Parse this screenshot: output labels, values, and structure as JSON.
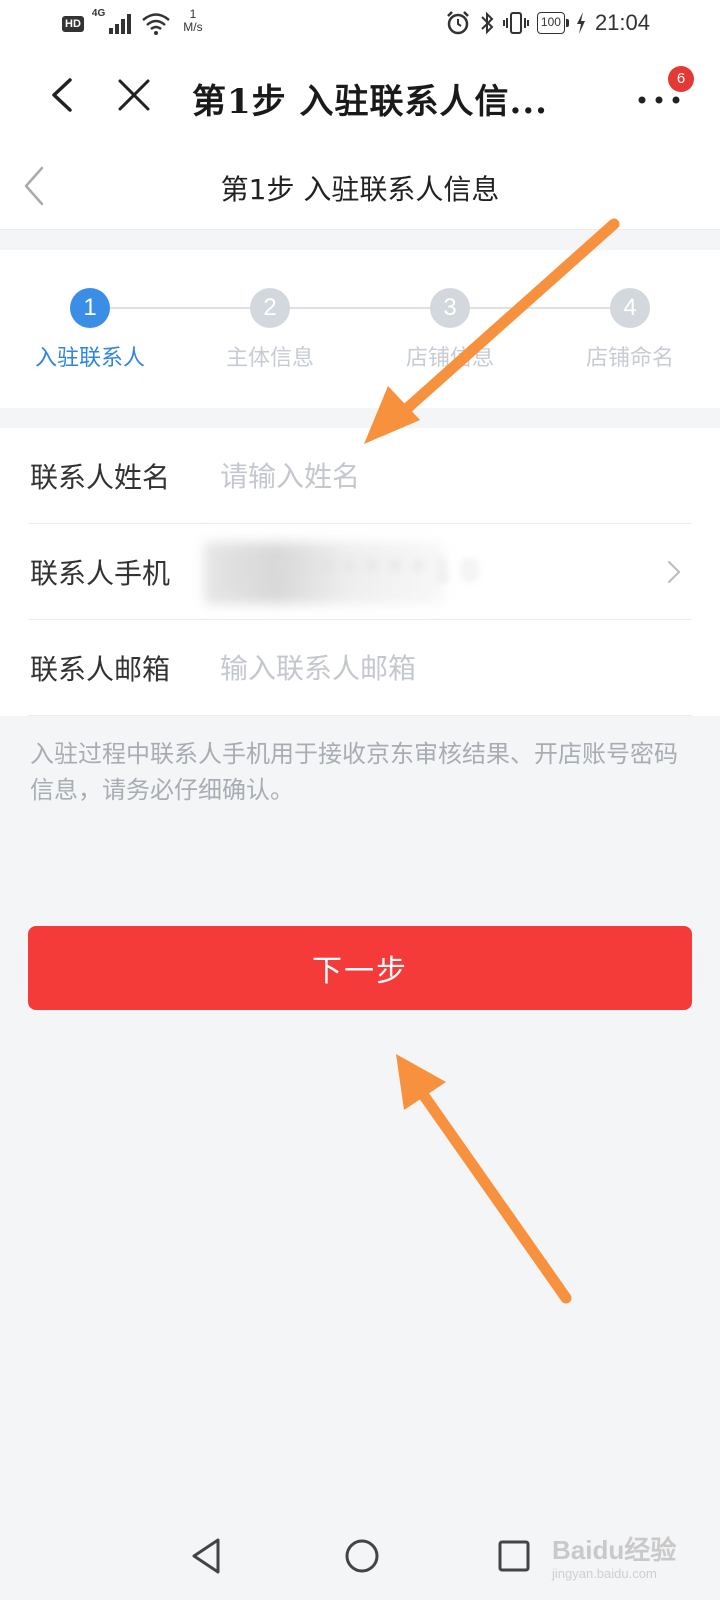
{
  "status_bar": {
    "hd": "HD",
    "network": "4G",
    "speed_value": "1",
    "speed_unit": "M/s",
    "battery": "100",
    "time": "21:04",
    "icons": [
      "alarm-icon",
      "bluetooth-icon",
      "vibrate-icon",
      "charging-icon"
    ]
  },
  "app_bar": {
    "title": "第1步 入驻联系人信...",
    "badge_count": "6"
  },
  "nav_bar": {
    "title": "第1步 入驻联系人信息"
  },
  "steps": [
    {
      "number": "1",
      "label": "入驻联系人",
      "active": true
    },
    {
      "number": "2",
      "label": "主体信息",
      "active": false
    },
    {
      "number": "3",
      "label": "店铺信息",
      "active": false
    },
    {
      "number": "4",
      "label": "店铺命名",
      "active": false
    }
  ],
  "form": {
    "name": {
      "label": "联系人姓名",
      "placeholder": "请输入姓名"
    },
    "phone": {
      "label": "联系人手机",
      "value": "1 * * * * * * * * 1 0"
    },
    "email": {
      "label": "联系人邮箱",
      "placeholder": "输入联系人邮箱"
    }
  },
  "notice": "入驻过程中联系人手机用于接收京东审核结果、开店账号密码信息，请务必仔细确认。",
  "next_button": "下一步",
  "watermark": {
    "main": "Baidu经验",
    "sub": "jingyan.baidu.com"
  },
  "colors": {
    "accent_blue": "#3a8ee6",
    "primary_red": "#f53a3a",
    "annotation_orange": "#f7913d"
  }
}
